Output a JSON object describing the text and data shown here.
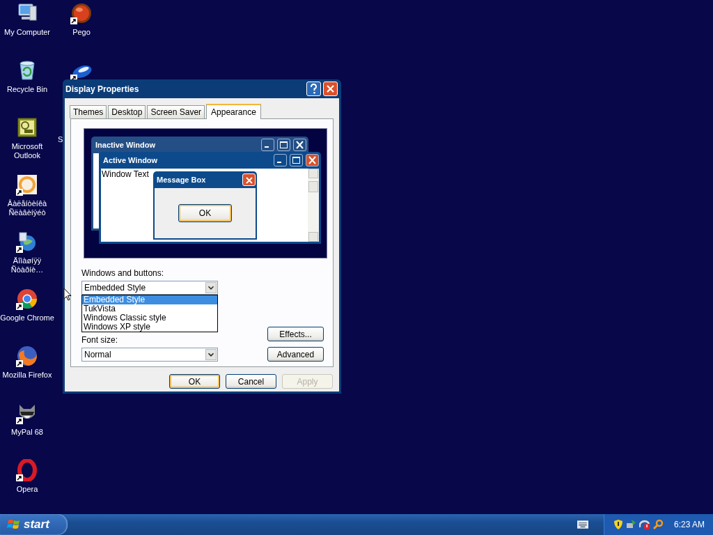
{
  "desktop_icons": [
    {
      "label": "My Computer",
      "kind": "computer",
      "shortcut": false
    },
    {
      "label": "Recycle Bin",
      "kind": "recycle",
      "shortcut": false
    },
    {
      "label": "Microsoft Outlook",
      "kind": "outlook",
      "shortcut": false
    },
    {
      "label": "Âàëåíòèíêà Ñëàâèíýéò",
      "kind": "ring",
      "shortcut": true
    },
    {
      "label": "Äîìàøíÿÿ Ñòàðíè…",
      "kind": "globe",
      "shortcut": true
    },
    {
      "label": "Google Chrome",
      "kind": "chrome",
      "shortcut": true
    },
    {
      "label": "Mozilla Firefox",
      "kind": "firefox",
      "shortcut": true
    },
    {
      "label": "MyPal 68",
      "kind": "raccoon",
      "shortcut": true
    },
    {
      "label": "Opera",
      "kind": "opera",
      "shortcut": true
    }
  ],
  "desktop_icons_column_2": [
    {
      "label": "Pego",
      "kind": "ball",
      "shortcut": true
    },
    {
      "kind": "disc",
      "shortcut": true
    },
    {
      "label": "S",
      "kind": "covered"
    }
  ],
  "dialog": {
    "title": "Display Properties",
    "tabs": [
      {
        "label": "Themes",
        "selected": false
      },
      {
        "label": "Desktop",
        "selected": false
      },
      {
        "label": "Screen Saver",
        "selected": false
      },
      {
        "label": "Appearance",
        "selected": true
      }
    ],
    "preview": {
      "inactive_title": "Inactive Window",
      "active_title": "Active Window",
      "window_text": "Window Text",
      "message_title": "Message Box",
      "message_button": "OK"
    },
    "windows_and_buttons": {
      "label": "Windows and buttons:",
      "value": "Embedded Style",
      "options": [
        {
          "label": "Embedded Style",
          "selected": true
        },
        {
          "label": "TukVista",
          "selected": false
        },
        {
          "label": "Windows Classic style",
          "selected": false
        },
        {
          "label": "Windows XP style",
          "selected": false
        }
      ]
    },
    "font_size": {
      "label": "Font size:",
      "value": "Normal"
    },
    "side_buttons": [
      {
        "label": "Effects..."
      },
      {
        "label": "Advanced"
      }
    ],
    "buttons": [
      {
        "label": "OK",
        "kind": "default",
        "disabled": false
      },
      {
        "label": "Cancel",
        "kind": "normal",
        "disabled": false
      },
      {
        "label": "Apply",
        "kind": "normal",
        "disabled": true
      }
    ]
  },
  "taskbar": {
    "start": "start",
    "clock": "6:23 AM"
  }
}
